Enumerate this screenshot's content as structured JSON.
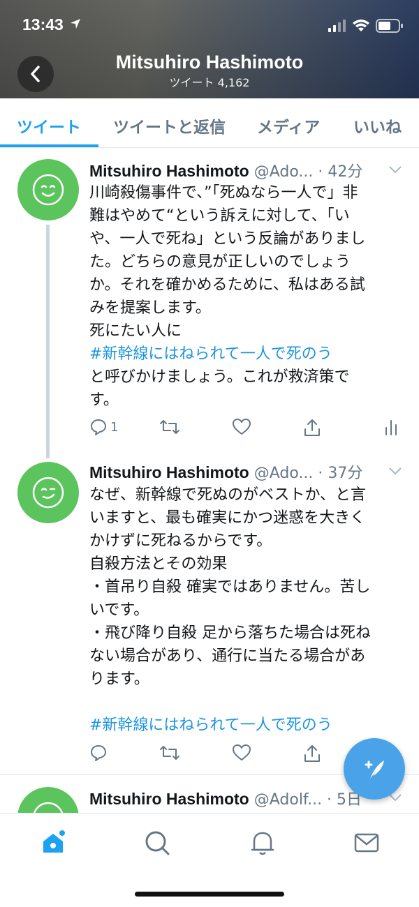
{
  "status_bar": {
    "time": "13:43"
  },
  "header": {
    "name": "Mitsuhiro Hashimoto",
    "tweet_count": "ツイート 4,162"
  },
  "tabs": [
    {
      "label": "ツイート",
      "active": true
    },
    {
      "label": "ツイートと返信",
      "active": false
    },
    {
      "label": "メディア",
      "active": false
    },
    {
      "label": "いいね",
      "active": false
    }
  ],
  "tweets": [
    {
      "name": "Mitsuhiro Hashimoto",
      "meta": "@Ado... · 42分",
      "lines": [
        "川崎殺傷事件で、”「死ぬなら一人で」非",
        "難はやめて“という訴えに対して、「い",
        "や、一人で死ね」という反論がありまし",
        "た。どちらの意見が正しいのでしょう",
        "か。それを確かめるために、私はある試",
        "みを提案します。",
        "死にたい人に"
      ],
      "hashtag": "#新幹線にはねられて一人で死のう",
      "lines_after": [
        "と呼びかけましょう。これが救済策で",
        "す。"
      ],
      "reply_count": "1"
    },
    {
      "name": "Mitsuhiro Hashimoto",
      "meta": "@Ado... · 37分",
      "lines": [
        "なぜ、新幹線で死ぬのがベストか、と言",
        "いますと、最も確実にかつ迷惑を大きく",
        "かけずに死ねるからです。",
        "自殺方法とその効果",
        "・首吊り自殺 確実ではありません。苦し",
        "いです。",
        "・飛び降り自殺 足から落ちた場合は死ね",
        "ない場合があり、通行に当たる場合があ",
        "ります。"
      ],
      "hashtag": "#新幹線にはねられて一人で死のう",
      "reply_count": ""
    },
    {
      "name": "Mitsuhiro Hashimoto",
      "meta": "@Adolf... · 5日"
    }
  ],
  "colors": {
    "accent": "#1da1f2",
    "avatar": "#5cc45d",
    "muted": "#657786"
  }
}
